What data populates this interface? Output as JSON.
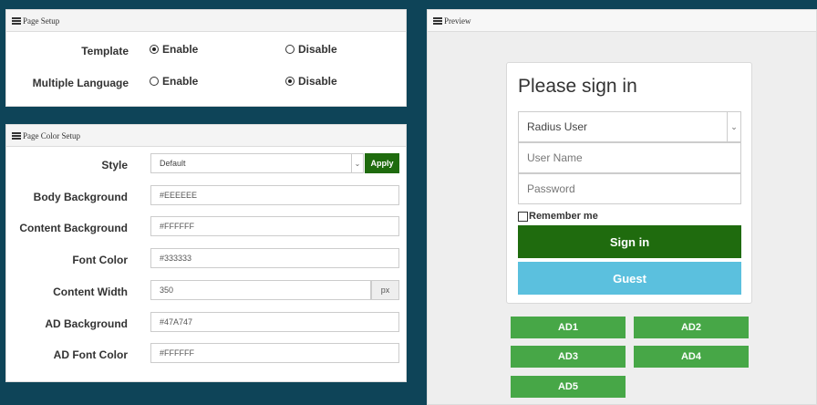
{
  "page_setup": {
    "title": "Page Setup",
    "rows": [
      {
        "label": "Template",
        "options": [
          "Enable",
          "Disable"
        ],
        "selected": "Enable"
      },
      {
        "label": "Multiple Language",
        "options": [
          "Enable",
          "Disable"
        ],
        "selected": "Disable"
      }
    ]
  },
  "color_setup": {
    "title": "Page Color Setup",
    "style": {
      "label": "Style",
      "value": "Default",
      "apply_label": "Apply"
    },
    "fields": [
      {
        "label": "Body Background",
        "value": "#EEEEEE"
      },
      {
        "label": "Content Background",
        "value": "#FFFFFF"
      },
      {
        "label": "Font Color",
        "value": "#333333"
      },
      {
        "label": "Content Width",
        "value": "350",
        "unit": "px"
      },
      {
        "label": "AD Background",
        "value": "#47A747"
      },
      {
        "label": "AD Font Color",
        "value": "#FFFFFF"
      }
    ]
  },
  "preview": {
    "title": "Preview",
    "signin_title": "Please sign in",
    "user_type": "Radius User",
    "username_placeholder": "User Name",
    "password_placeholder": "Password",
    "remember_label": "Remember me",
    "signin_button": "Sign in",
    "guest_button": "Guest",
    "ads": [
      "AD1",
      "AD2",
      "AD3",
      "AD4",
      "AD5"
    ]
  },
  "colors": {
    "apply": "#1f6b0e",
    "signin": "#1f6b0e",
    "guest": "#5bc0de",
    "ad": "#47a747",
    "background": "#0e4458"
  }
}
